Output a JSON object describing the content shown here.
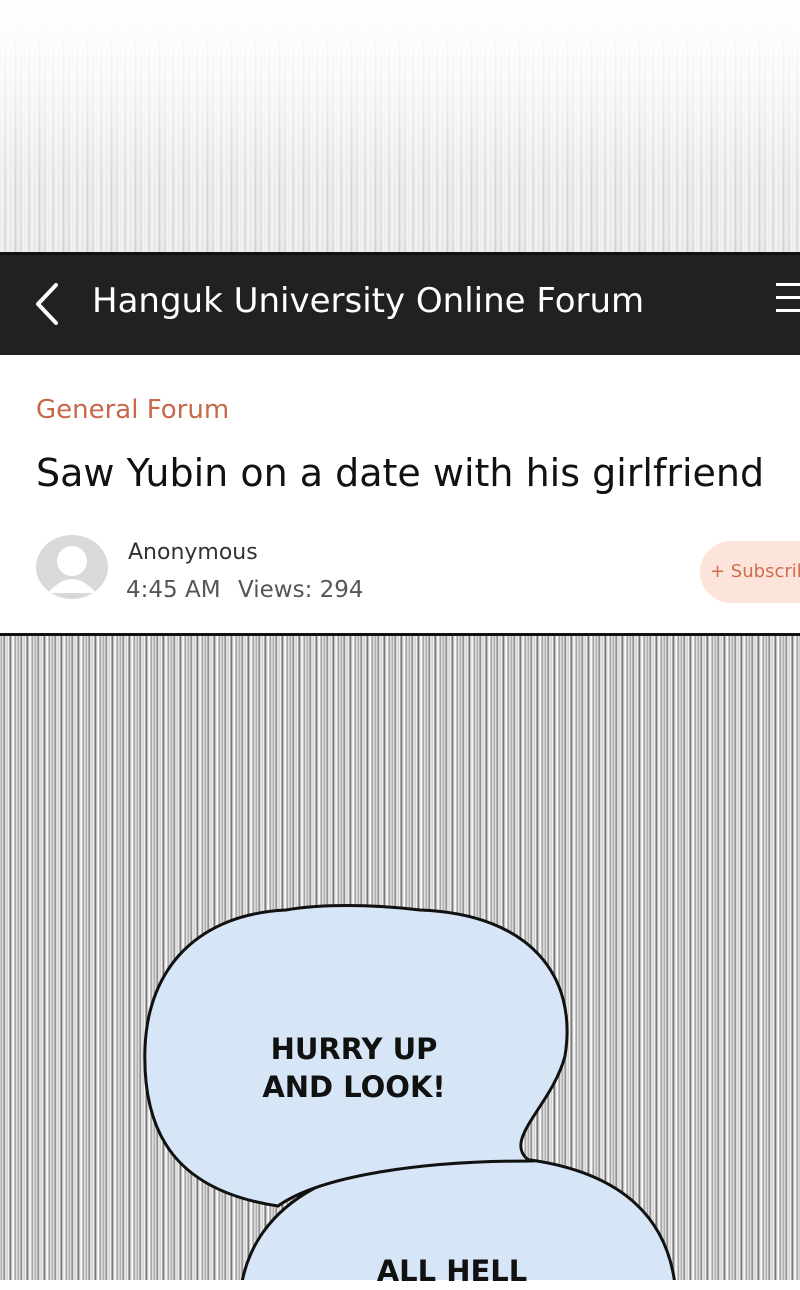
{
  "header": {
    "title": "Hanguk University Online Forum",
    "back_icon": "chevron-left-icon",
    "menu_icon": "hamburger-menu-icon"
  },
  "post": {
    "category": "General Forum",
    "title": "Saw Yubin on a date with his girlfriend",
    "author": "Anonymous",
    "time": "4:45 AM",
    "views": "Views: 294",
    "subscribe_label": "+ Subscribe",
    "avatar_icon": "default-user-avatar-icon"
  },
  "speech": {
    "bubble_1_lines": [
      "HURRY UP",
      "AND LOOK!"
    ],
    "bubble_2_text": "ALL HELL"
  },
  "colors": {
    "header_bg": "#212121",
    "category_accent": "#c7684a",
    "subscribe_bg": "#fde4db",
    "subscribe_text": "#d26c4e",
    "bubble_fill": "#d6e6f6"
  }
}
